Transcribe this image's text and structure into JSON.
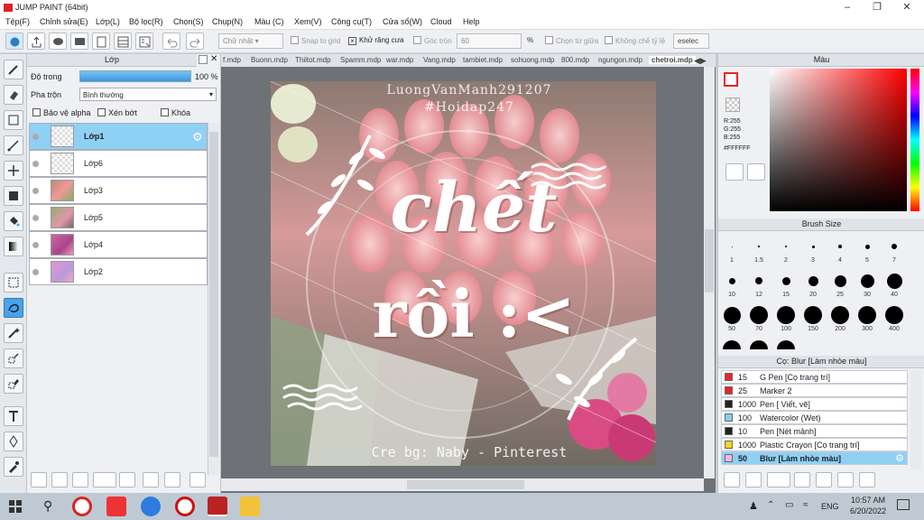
{
  "window": {
    "title": "JUMP PAINT (64bit)"
  },
  "menu": [
    "Tệp(F)",
    "Chỉnh sửa(E)",
    "Lớp(L)",
    "Bộ lọc(R)",
    "Chọn(S)",
    "Chụp(N)",
    "Màu (C)",
    "Xem(V)",
    "Công cụ(T)",
    "Cửa sổ(W)",
    "Cloud",
    "Help"
  ],
  "toolbar": {
    "shape_select": "Chữ nhật",
    "snap_to_grid": "Snap to grid",
    "antialias": "Khử răng cưa",
    "corner_round": "Góc tròn",
    "corner_value": "60",
    "percent": "%",
    "center_select": "Chọn từ giữa",
    "no_limit": "Không chế tỷ lệ",
    "deselect": "eselec"
  },
  "layer_panel": {
    "title": "Lớp",
    "opacity_label": "Độ trong",
    "opacity_value": "100 %",
    "opacity_percent": 100,
    "blend_label": "Pha trộn",
    "blend_value": "Bình thường",
    "protect_alpha": "Bảo vệ alpha",
    "clipping": "Xén bớt",
    "lock": "Khóa",
    "layers": [
      {
        "name": "Lớp1",
        "selected": true
      },
      {
        "name": "Lớp6",
        "selected": false
      },
      {
        "name": "Lớp3",
        "selected": false
      },
      {
        "name": "Lớp5",
        "selected": false
      },
      {
        "name": "Lớp4",
        "selected": false
      },
      {
        "name": "Lớp2",
        "selected": false
      }
    ]
  },
  "doc_tabs": [
    "f.mdp",
    "Buonn.mdp",
    "Thiitot.mdp",
    "Spamm.mdp",
    "war.mdp",
    "Vang.mdp",
    "tambiet.mdp",
    "sohuong.mdp",
    "800.mdp",
    "ngungon.mdp",
    "chetroi.mdp"
  ],
  "artwork": {
    "watermark_name": "LuongVanManh291207",
    "watermark_tag": "#Hoidap247",
    "line1": "chết",
    "line2": "rồi :<",
    "credit": "Cre bg: Naby - Pinterest"
  },
  "color_panel": {
    "title": "Màu",
    "r": "R:255",
    "g": "G:255",
    "b": "B:255",
    "hex": "#FFFFFF"
  },
  "brush_size": {
    "title": "Brush Size",
    "sizes": [
      "1",
      "1.5",
      "2",
      "3",
      "4",
      "5",
      "7",
      "10",
      "12",
      "15",
      "20",
      "25",
      "30",
      "40",
      "50",
      "70",
      "100",
      "150",
      "200",
      "300",
      "400"
    ]
  },
  "brush_panel": {
    "title": "Cọ: Blur [Làm nhòe màu]",
    "items": [
      {
        "size": "15",
        "name": "G Pen [Cọ trang trí]",
        "color": "#e8262b",
        "selected": false
      },
      {
        "size": "25",
        "name": "Marker 2",
        "color": "#e8262b",
        "selected": false
      },
      {
        "size": "1000",
        "name": "Pen [ Viết, vẽ]",
        "color": "#222222",
        "selected": false
      },
      {
        "size": "100",
        "name": "Watercolor (Wet)",
        "color": "#7fd0f0",
        "selected": false
      },
      {
        "size": "10",
        "name": "Pen [Nét mảnh]",
        "color": "#222222",
        "selected": false
      },
      {
        "size": "1000",
        "name": "Plastic Crayon [Cọ trang trí]",
        "color": "#f2d71f",
        "selected": false
      },
      {
        "size": "50",
        "name": "Blur [Làm nhòe màu]",
        "color": "#f4b6e6",
        "selected": true
      }
    ]
  },
  "taskbar": {
    "lang": "ENG",
    "time": "10:57 AM",
    "date": "6/20/2022"
  }
}
